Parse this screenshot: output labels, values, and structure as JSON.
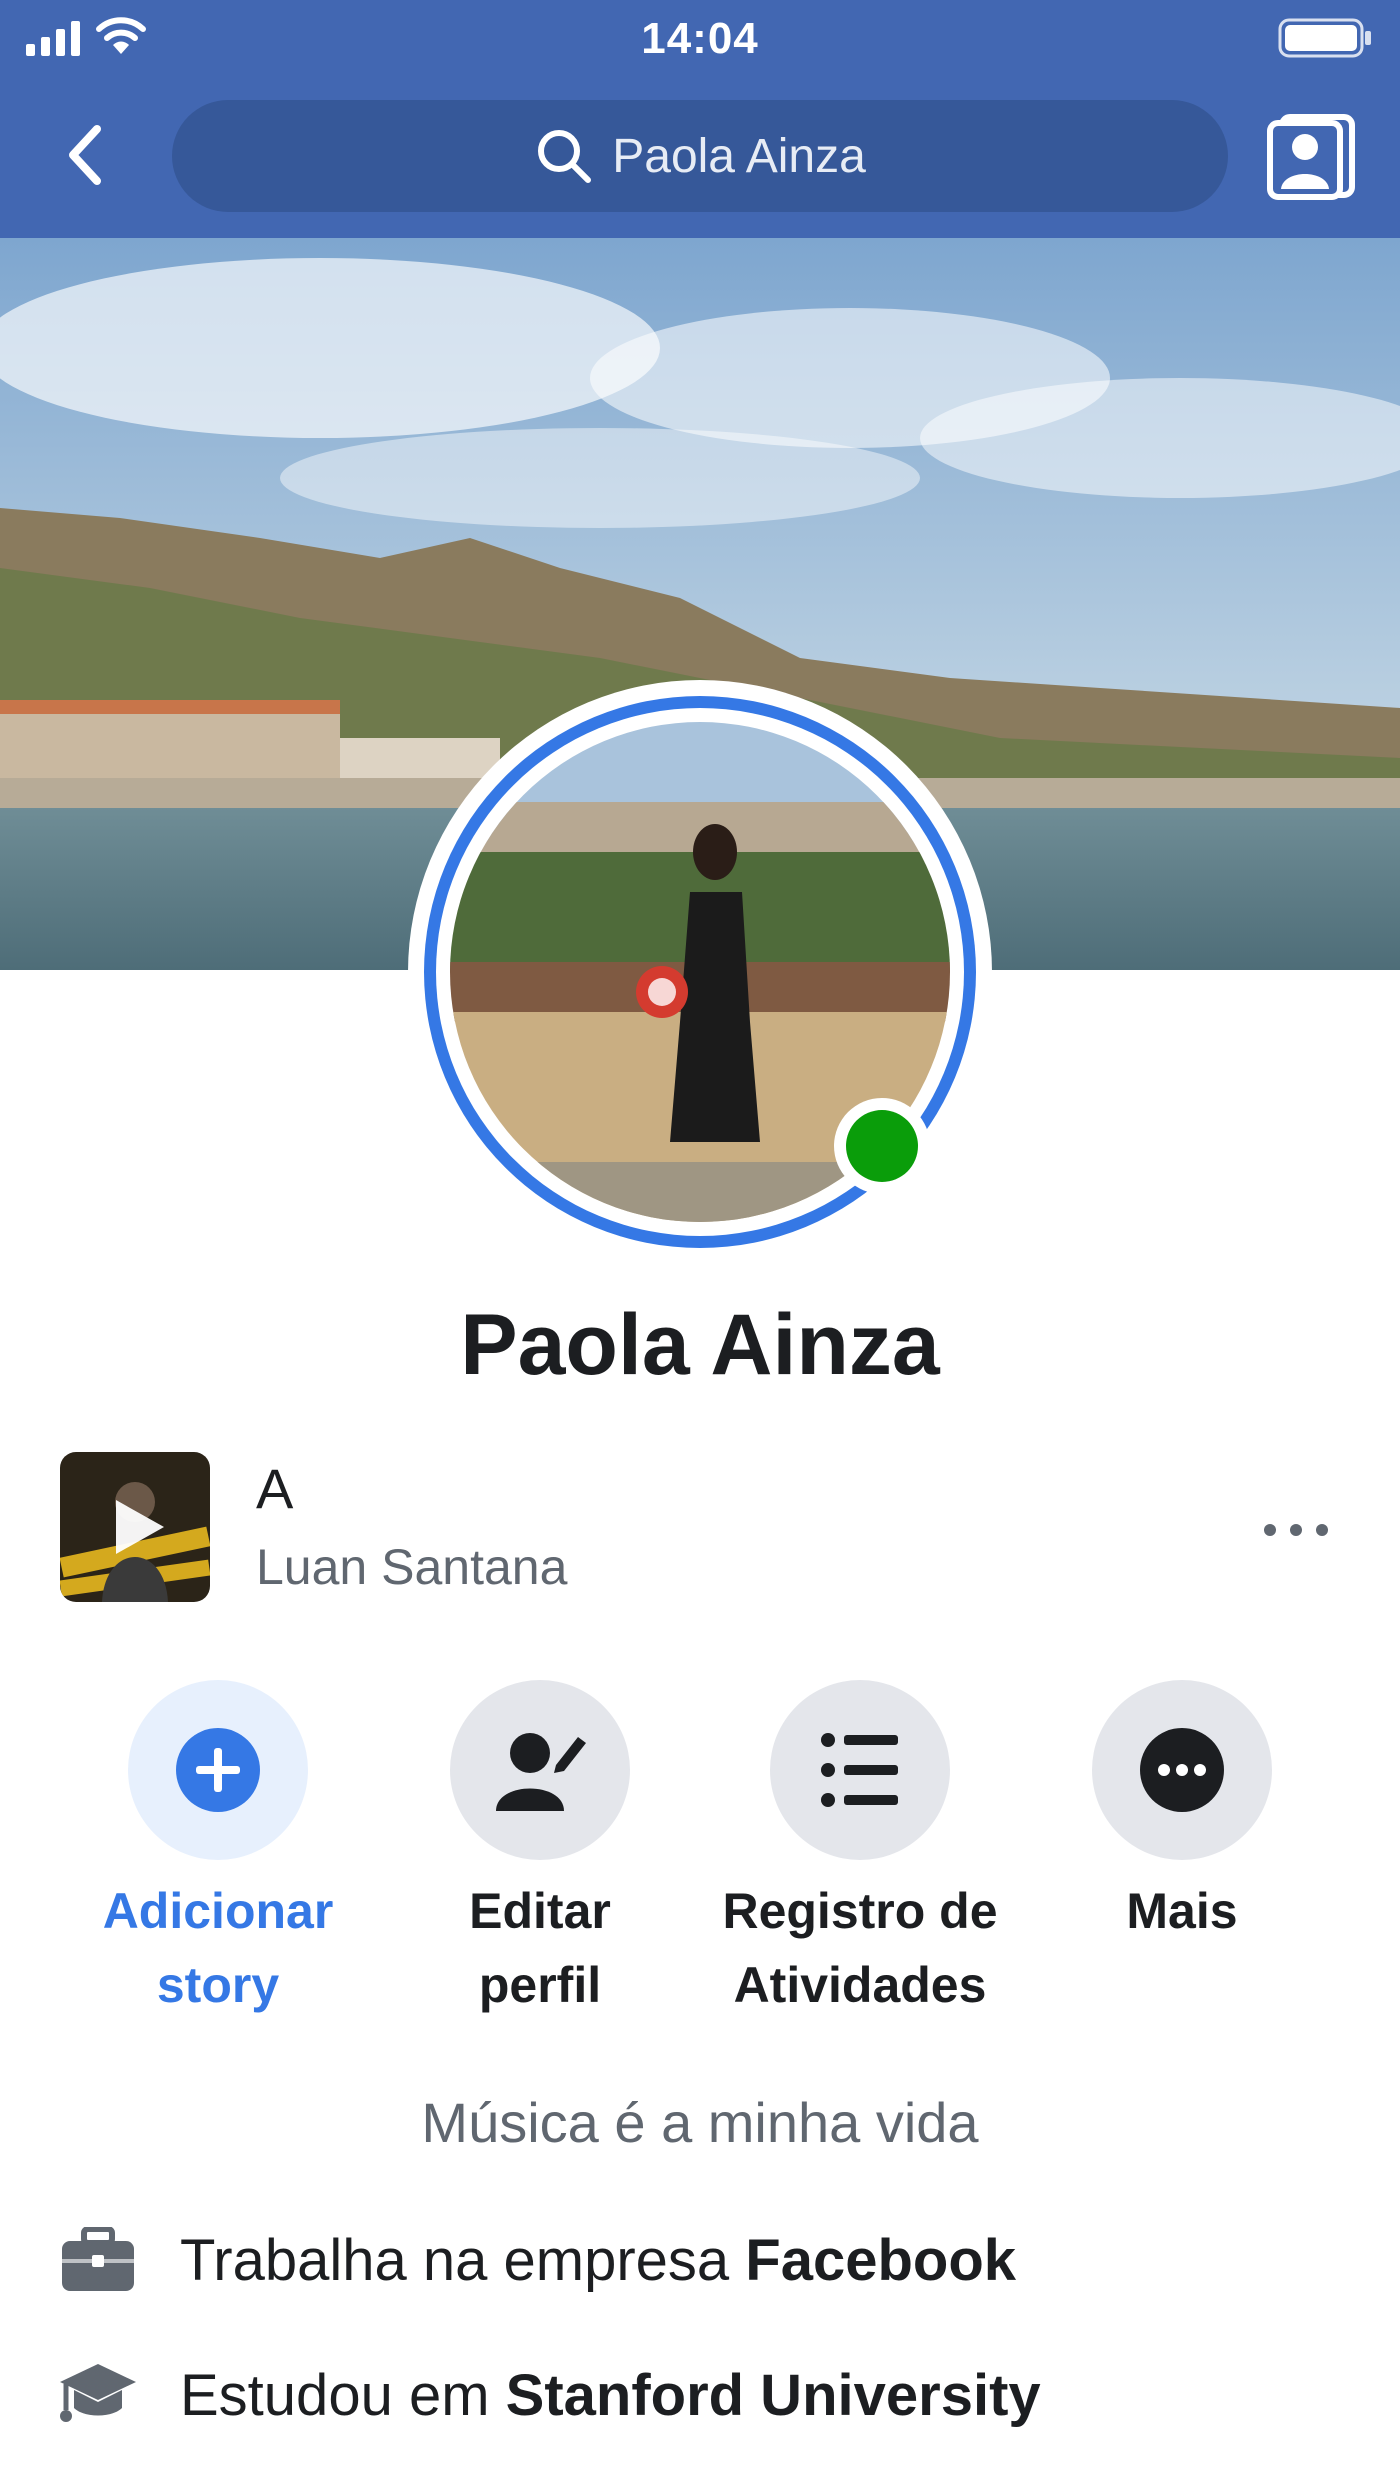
{
  "status_bar": {
    "time": "14:04"
  },
  "search": {
    "value": "Paola Ainza"
  },
  "profile": {
    "name": "Paola Ainza"
  },
  "music": {
    "title": "A",
    "artist": "Luan Santana"
  },
  "actions": [
    {
      "label_line1": "Adicionar",
      "label_line2": "story"
    },
    {
      "label_line1": "Editar",
      "label_line2": "perfil"
    },
    {
      "label_line1": "Registro de",
      "label_line2": "Atividades"
    },
    {
      "label_line1": "Mais",
      "label_line2": ""
    }
  ],
  "bio": "Música é a minha vida",
  "info": {
    "work_prefix": "Trabalha na empresa ",
    "work_company": "Facebook",
    "study_prefix": "Estudou em ",
    "study_school": "Stanford University"
  },
  "colors": {
    "header": "#4267b2",
    "search_box": "#365899",
    "accent": "#3578e5",
    "online": "#0a9d0a"
  },
  "icons": [
    "signal-icon",
    "wifi-icon",
    "battery-icon",
    "back-arrow-icon",
    "search-icon",
    "contact-card-icon",
    "play-icon",
    "plus-icon",
    "edit-profile-icon",
    "list-icon",
    "more-icon",
    "briefcase-icon",
    "graduation-cap-icon"
  ]
}
